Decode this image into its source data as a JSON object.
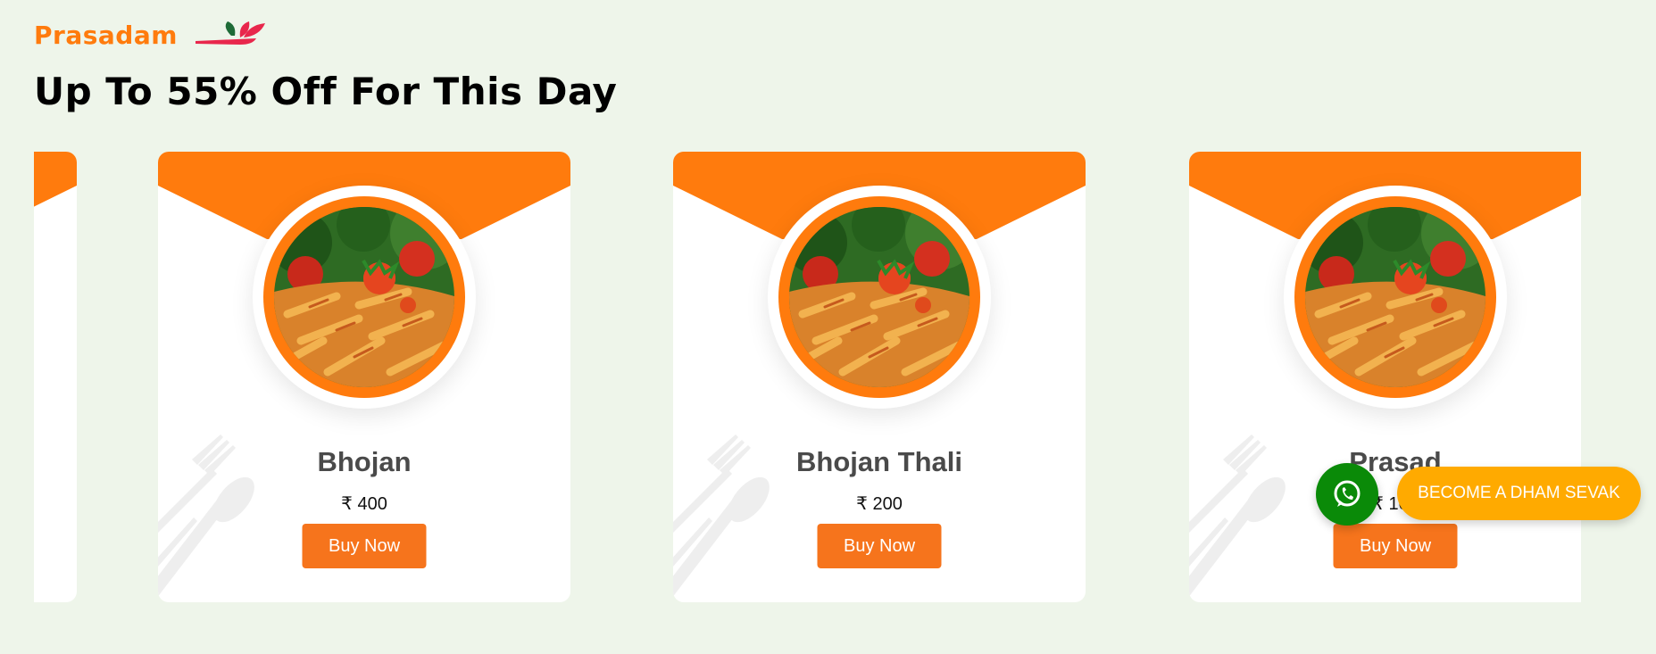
{
  "brand": {
    "name": "Prasadam",
    "logo_icon": "leaf-spoon-logo-icon"
  },
  "headline": "Up To 55% Off For This Day",
  "colors": {
    "brand_orange": "#ff7b0d",
    "button_orange": "#f6741c",
    "page_bg": "#eef5ea",
    "whatsapp_green": "#0a8a08",
    "sevak_yellow": "#ffaa00"
  },
  "cards": [
    {
      "title": "Bhojan",
      "price": "₹ 400",
      "button": "Buy Now",
      "image_icon": "penne-pasta-image"
    },
    {
      "title": "Bhojan Thali",
      "price": "₹ 200",
      "button": "Buy Now",
      "image_icon": "penne-pasta-image"
    },
    {
      "title": "Prasad",
      "price": "₹ 100",
      "button": "Buy Now",
      "image_icon": "penne-pasta-image"
    }
  ],
  "floating": {
    "whatsapp_icon": "whatsapp-icon",
    "sevak_button": "BECOME A DHAM SEVAK"
  }
}
